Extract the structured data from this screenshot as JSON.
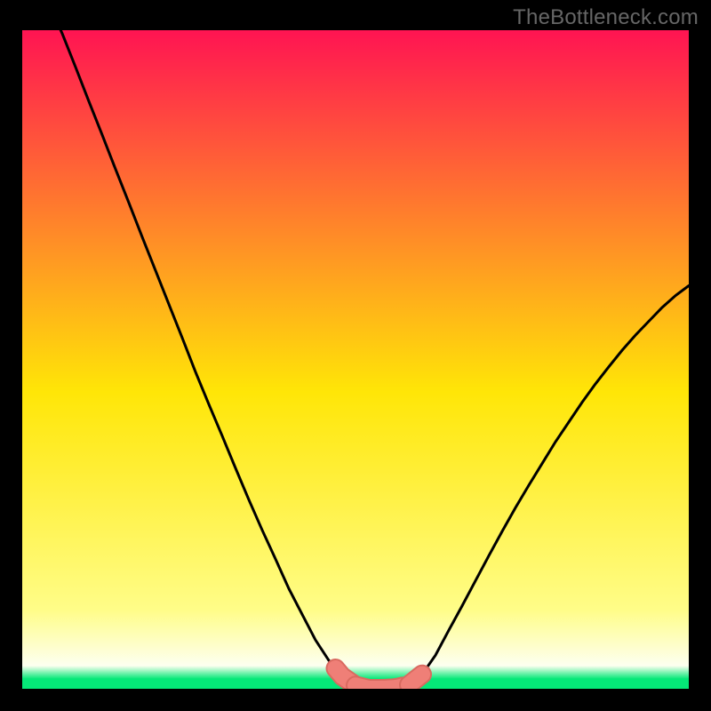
{
  "attribution": "TheBottleneck.com",
  "colors": {
    "gradient_top": "#ff1452",
    "gradient_mid": "#ffe607",
    "gradient_bottom_yellow": "#fffd88",
    "gradient_green": "#05e878",
    "curve": "#000000",
    "marker_fill": "#ef7f77",
    "marker_stroke": "#d96a60",
    "frame": "#000000",
    "attribution_text": "#666666"
  },
  "chart_data": {
    "type": "line",
    "title": "",
    "xlabel": "",
    "ylabel": "",
    "xlim": [
      0,
      100
    ],
    "ylim": [
      0,
      100
    ],
    "series": [
      {
        "name": "bottleneck-curve",
        "x": [
          4,
          6,
          8,
          10,
          12,
          14,
          16,
          18,
          20,
          22,
          24,
          26,
          28,
          30,
          32,
          34,
          36,
          38,
          40,
          42,
          44,
          46,
          48,
          50,
          52,
          54,
          56,
          58,
          60,
          62,
          64,
          66,
          68,
          70,
          72,
          74,
          76,
          78,
          80,
          82,
          84,
          86,
          88,
          90,
          92,
          94,
          96,
          98,
          100
        ],
        "values": [
          104,
          99.5,
          94.4,
          89.2,
          84.1,
          78.9,
          73.8,
          68.6,
          63.5,
          58.4,
          53.3,
          48.1,
          43.2,
          38.4,
          33.5,
          28.7,
          24.1,
          19.7,
          15.2,
          11.3,
          7.4,
          4.3,
          1.9,
          0.5,
          0,
          0,
          0.1,
          0.6,
          2.2,
          5.1,
          8.9,
          12.6,
          16.4,
          20.2,
          23.9,
          27.5,
          30.9,
          34.2,
          37.5,
          40.5,
          43.5,
          46.3,
          48.9,
          51.4,
          53.7,
          55.8,
          57.9,
          59.7,
          61.2
        ]
      }
    ],
    "markers": [
      {
        "x_start": 47,
        "x_end": 49.5,
        "label": "left-end-marker"
      },
      {
        "x_start": 50,
        "x_end": 57,
        "label": "bottom-flat-marker"
      },
      {
        "x_start": 58,
        "x_end": 60,
        "label": "right-end-marker"
      }
    ],
    "optimal_range_x": [
      50,
      57
    ],
    "legend": []
  }
}
